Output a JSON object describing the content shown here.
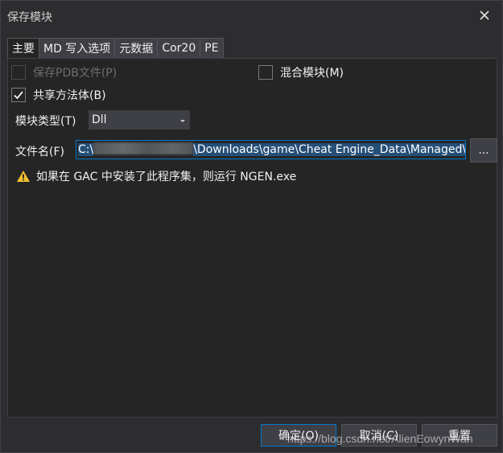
{
  "window": {
    "title": "保存模块",
    "close_icon": "close-icon"
  },
  "tabs": [
    {
      "label": "主要",
      "active": true
    },
    {
      "label": "MD 写入选项"
    },
    {
      "label": "元数据"
    },
    {
      "label": "Cor20"
    },
    {
      "label": "PE"
    }
  ],
  "main": {
    "save_pdb": {
      "label": "保存PDB文件(P)",
      "checked": false,
      "enabled": false
    },
    "mixed_module": {
      "label": "混合模块(M)",
      "checked": false
    },
    "share_method_bodies": {
      "label": "共享方法体(B)",
      "checked": true
    },
    "module_type": {
      "label": "模块类型(T)",
      "value": "Dll"
    },
    "filename": {
      "label": "文件名(F)",
      "value_start": "C:\\",
      "value_end": "\\Downloads\\game\\Cheat Engine_Data\\Managed\\A",
      "browse_label": "..."
    },
    "warning": {
      "icon": "warning-icon",
      "text": "如果在 GAC 中安装了此程序集，则运行 NGEN.exe"
    }
  },
  "buttons": {
    "ok": "确定(O)",
    "cancel": "取消(C)",
    "reset": "重置"
  },
  "watermark": "https://blog.csdn.net/AlienEowynWan",
  "colors": {
    "background": "#2d2d30",
    "panel": "#252526",
    "accent": "#007acc",
    "warning": "#f2c12e"
  }
}
